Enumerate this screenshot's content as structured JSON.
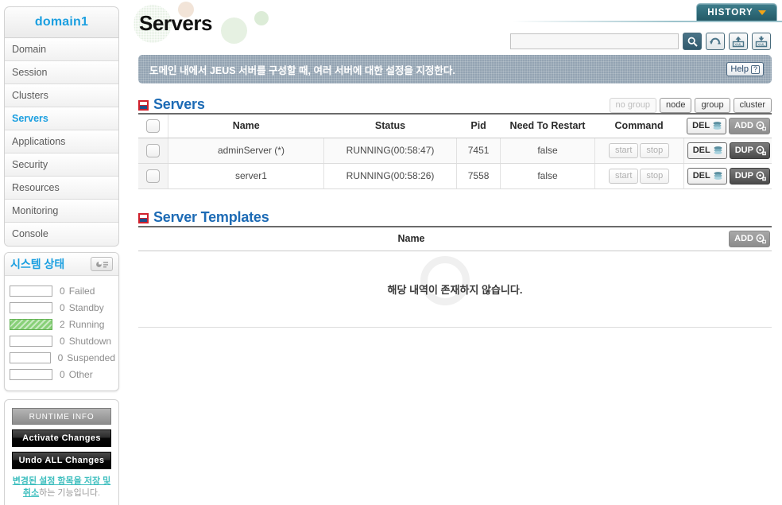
{
  "sidebar": {
    "domain_title": "domain1",
    "nav_items": [
      {
        "label": "Domain",
        "active": false
      },
      {
        "label": "Session",
        "active": false
      },
      {
        "label": "Clusters",
        "active": false
      },
      {
        "label": "Servers",
        "active": true
      },
      {
        "label": "Applications",
        "active": false
      },
      {
        "label": "Security",
        "active": false
      },
      {
        "label": "Resources",
        "active": false
      },
      {
        "label": "Monitoring",
        "active": false
      },
      {
        "label": "Console",
        "active": false
      }
    ],
    "status": {
      "title": "시스템 상태",
      "report_icon": "report-chart-icon",
      "rows": [
        {
          "count": "0",
          "label": "Failed",
          "filled": false
        },
        {
          "count": "0",
          "label": "Standby",
          "filled": false
        },
        {
          "count": "2",
          "label": "Running",
          "filled": true
        },
        {
          "count": "0",
          "label": "Shutdown",
          "filled": false
        },
        {
          "count": "0",
          "label": "Suspended",
          "filled": false
        },
        {
          "count": "0",
          "label": "Other",
          "filled": false
        }
      ]
    },
    "actions": {
      "runtime_info_label": "RUNTIME INFO",
      "activate_label": "Activate Changes",
      "undo_label": "Undo ALL Changes",
      "description_link": "변경된 설정 항목을 저장 및 취소",
      "description_tail": "하는 기능입니다."
    }
  },
  "header": {
    "page_title": "Servers",
    "history_label": "HISTORY",
    "history_icon": "chevron-down-icon",
    "search_value": "",
    "search_placeholder": "",
    "toolbar_buttons": [
      {
        "icon": "search-icon",
        "primary": true
      },
      {
        "icon": "refresh-icon",
        "primary": false
      },
      {
        "icon": "xml-import-icon",
        "primary": false
      },
      {
        "icon": "xml-export-icon",
        "primary": false
      }
    ]
  },
  "banner": {
    "text": "도메인 내에서 JEUS 서버를 구성할 때, 여러 서버에 대한 설정을 지정한다.",
    "help_label": "Help",
    "help_icon": "question-icon"
  },
  "servers_section": {
    "title": "Servers",
    "bullet_icon": "section-bullet-icon",
    "group_buttons": [
      {
        "label": "no group",
        "disabled": true
      },
      {
        "label": "node",
        "disabled": false
      },
      {
        "label": "group",
        "disabled": false
      },
      {
        "label": "cluster",
        "disabled": false
      }
    ],
    "columns": [
      "Name",
      "Status",
      "Pid",
      "Need To Restart",
      "Command"
    ],
    "header_actions": [
      {
        "label": "DEL",
        "icon": "stack-delete-icon",
        "style": "del"
      },
      {
        "label": "ADD",
        "icon": "gear-plus-icon",
        "style": "gray"
      }
    ],
    "rows": [
      {
        "name": "adminServer (*)",
        "status": "RUNNING(00:58:47)",
        "pid": "7451",
        "need_to_restart": "false",
        "commands": [
          "start",
          "stop"
        ],
        "actions": [
          {
            "label": "DEL",
            "icon": "stack-delete-icon",
            "style": "del"
          },
          {
            "label": "DUP",
            "icon": "gear-copy-icon",
            "style": "dark"
          }
        ]
      },
      {
        "name": "server1",
        "status": "RUNNING(00:58:26)",
        "pid": "7558",
        "need_to_restart": "false",
        "commands": [
          "start",
          "stop"
        ],
        "actions": [
          {
            "label": "DEL",
            "icon": "stack-delete-icon",
            "style": "del"
          },
          {
            "label": "DUP",
            "icon": "gear-copy-icon",
            "style": "dark"
          }
        ]
      }
    ]
  },
  "templates_section": {
    "title": "Server Templates",
    "bullet_icon": "section-bullet-icon",
    "columns": [
      "Name"
    ],
    "header_actions": [
      {
        "label": "ADD",
        "icon": "gear-plus-icon",
        "style": "gray"
      }
    ],
    "empty_text": "해당 내역이 존재하지 않습니다."
  },
  "colors": {
    "brand_blue": "#1b9fe0",
    "section_blue": "#1d6bb5",
    "bullet_red": "#d0202c",
    "bullet_navy": "#1d4f8a",
    "banner_bg": "#93a3b2",
    "history_teal": "#2f6b79",
    "history_accent": "#f2a416",
    "running_green": "#88d078",
    "link_teal": "#3fbfbf"
  }
}
